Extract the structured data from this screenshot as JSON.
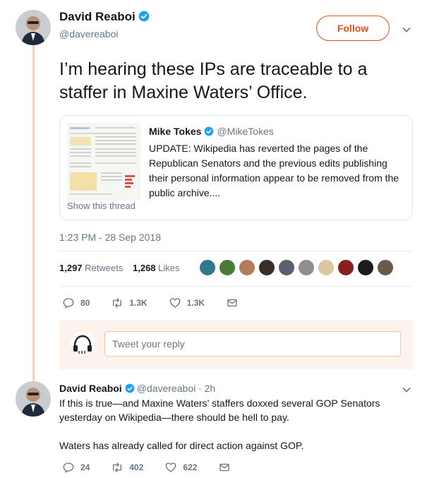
{
  "tweet": {
    "author_name": "David Reaboi",
    "handle": "@davereaboi",
    "follow_label": "Follow",
    "text": "I’m hearing these IPs are traceable to a staffer in Maxine Waters’ Office.",
    "timestamp": "1:23 PM - 28 Sep 2018",
    "retweets_count": "1,297",
    "retweets_label": "Retweets",
    "likes_count": "1,268",
    "likes_label": "Likes",
    "actions": {
      "replies": "80",
      "retweets": "1.3K",
      "likes": "1.3K"
    }
  },
  "quote": {
    "author_name": "Mike Tokes",
    "handle": "@MikeTokes",
    "text": "UPDATE: Wikipedia has reverted the pages of the Republican Senators and the previous edits publishing their personal information appear to be removed from the public archive....",
    "show_thread": "Show this thread"
  },
  "reply_box": {
    "placeholder": "Tweet your reply"
  },
  "reply": {
    "author_name": "David Reaboi",
    "handle": "@davereaboi · 2h",
    "paragraphs": [
      "If this is true—and Maxine Waters’ staffers doxxed several GOP Senators yesterday on Wikipedia—there should be hell to pay.",
      "Waters has already called for direct action against GOP."
    ],
    "actions": {
      "replies": "24",
      "retweets": "402",
      "likes": "622"
    }
  },
  "icons": {
    "verified": "verified-badge-icon",
    "reply": "reply-icon",
    "retweet": "retweet-icon",
    "like": "heart-icon",
    "dm": "envelope-icon",
    "caret": "chevron-down-icon"
  },
  "colors": {
    "accent": "#e0501e",
    "verified": "#1da1f2",
    "muted": "#657786",
    "thread_line": "#f5d3c0"
  }
}
